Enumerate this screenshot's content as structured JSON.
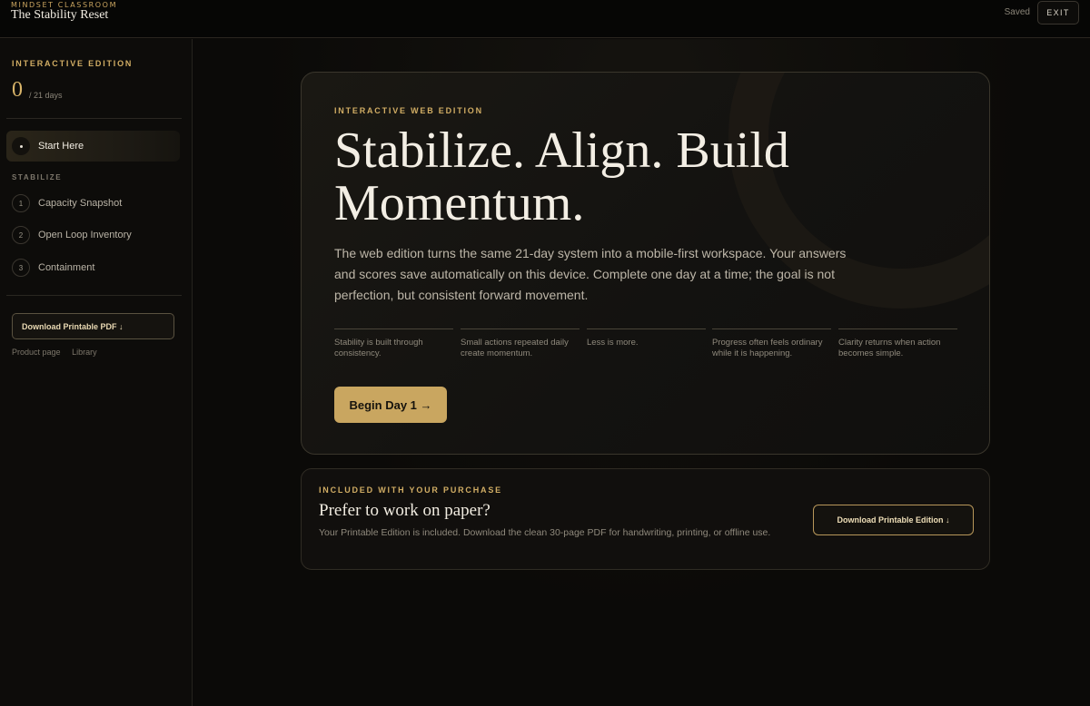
{
  "topbar": {
    "eyebrow": "MINDSET CLASSROOM",
    "title": "The Stability Reset",
    "saved_label": "Saved",
    "exit_label": "EXIT"
  },
  "sidebar": {
    "eyebrow": "INTERACTIVE EDITION",
    "progress_count": "0",
    "progress_total": "/ 21 days",
    "start_label": "Start Here",
    "section_label": "STABILIZE",
    "items": [
      {
        "num": "1",
        "label": "Capacity Snapshot"
      },
      {
        "num": "2",
        "label": "Open Loop Inventory"
      },
      {
        "num": "3",
        "label": "Containment"
      }
    ],
    "download_label": "Download Printable PDF ↓",
    "links": [
      "Product page",
      "Library"
    ]
  },
  "hero": {
    "eyebrow": "INTERACTIVE WEB EDITION",
    "title": "Stabilize. Align. Build Momentum.",
    "description": "The web edition turns the same 21-day system into a mobile-first workspace. Your answers and scores save automatically on this device. Complete one day at a time; the goal is not perfection, but consistent forward movement.",
    "principles": [
      "Stability is built through consistency.",
      "Small actions repeated daily create momentum.",
      "Less is more.",
      "Progress often feels ordinary while it is happening.",
      "Clarity returns when action becomes simple."
    ],
    "begin_label": "Begin Day 1 →"
  },
  "purchase": {
    "eyebrow": "INCLUDED WITH YOUR PURCHASE",
    "title": "Prefer to work on paper?",
    "description": "Your Printable Edition is included. Download the clean 30-page PDF for handwriting, printing, or offline use.",
    "download_label": "Download Printable Edition ↓"
  },
  "colors": {
    "accent": "#c9a660",
    "background": "#0b0a08",
    "panel": "#131210"
  },
  "icons": {
    "start_marker": "dot-icon",
    "arrow_right": "arrow-right-icon",
    "arrow_down": "arrow-down-icon"
  }
}
